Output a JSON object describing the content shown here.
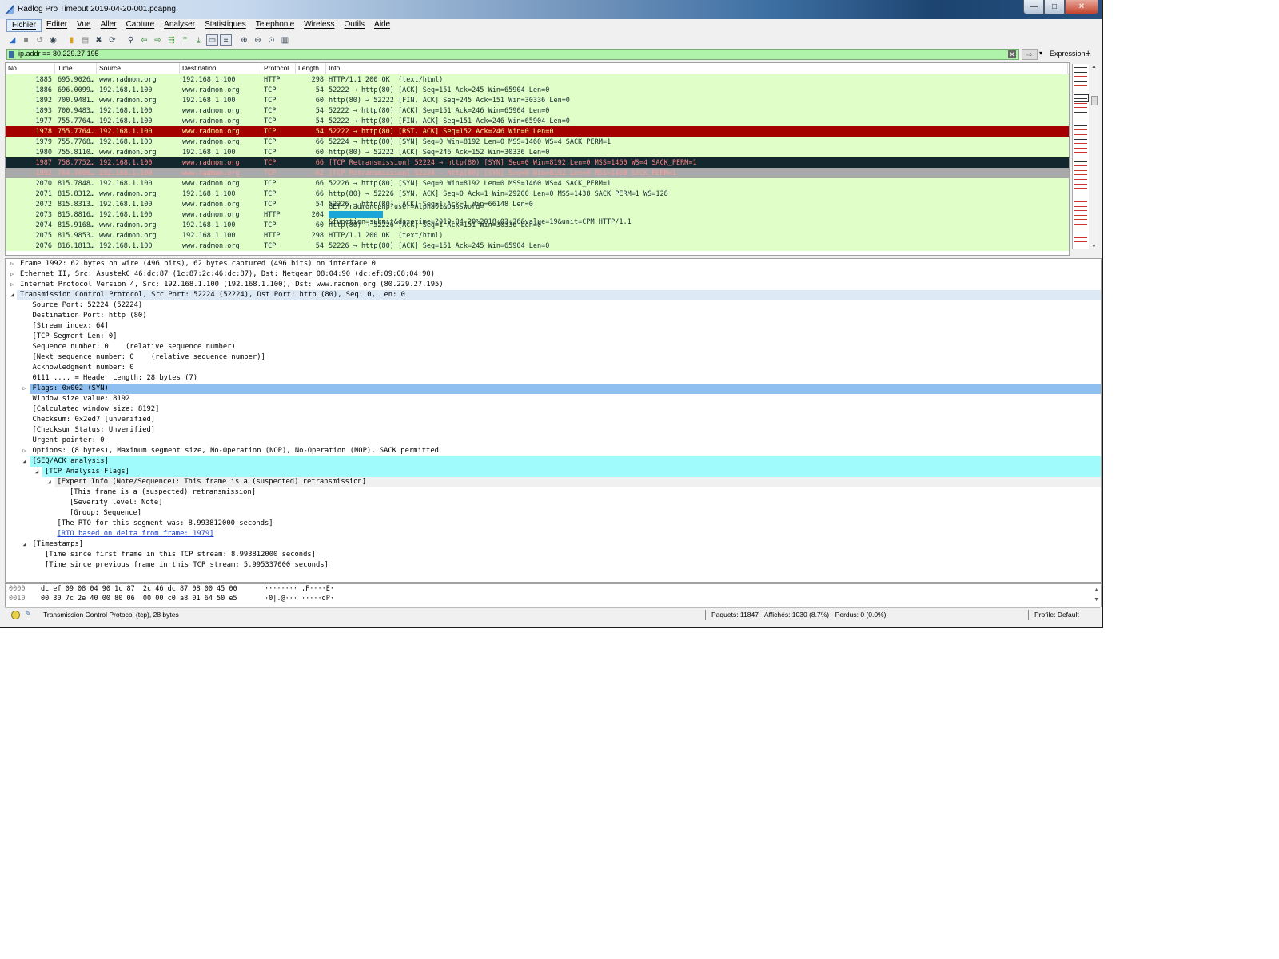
{
  "window": {
    "title": "Radlog Pro Timeout 2019-04-20-001.pcapng"
  },
  "menu": [
    "Fichier",
    "Editer",
    "Vue",
    "Aller",
    "Capture",
    "Analyser",
    "Statistiques",
    "Telephonie",
    "Wireless",
    "Outils",
    "Aide"
  ],
  "filter": {
    "value": "ip.addr == 80.229.27.195",
    "expression_label": "Expression...",
    "plus": "+"
  },
  "packet_list": {
    "headers": [
      "No.",
      "Time",
      "Source",
      "Destination",
      "Protocol",
      "Length",
      "Info"
    ],
    "rows": [
      {
        "no": "1885",
        "time": "695.9026…",
        "src": "www.radmon.org",
        "dst": "192.168.1.100",
        "proto": "HTTP",
        "len": "298",
        "info": "HTTP/1.1 200 OK  (text/html)",
        "style": "green"
      },
      {
        "no": "1886",
        "time": "696.0099…",
        "src": "192.168.1.100",
        "dst": "www.radmon.org",
        "proto": "TCP",
        "len": "54",
        "info": "52222 → http(80) [ACK] Seq=151 Ack=245 Win=65904 Len=0",
        "style": "green"
      },
      {
        "no": "1892",
        "time": "700.9481…",
        "src": "www.radmon.org",
        "dst": "192.168.1.100",
        "proto": "TCP",
        "len": "60",
        "info": "http(80) → 52222 [FIN, ACK] Seq=245 Ack=151 Win=30336 Len=0",
        "style": "green"
      },
      {
        "no": "1893",
        "time": "700.9483…",
        "src": "192.168.1.100",
        "dst": "www.radmon.org",
        "proto": "TCP",
        "len": "54",
        "info": "52222 → http(80) [ACK] Seq=151 Ack=246 Win=65904 Len=0",
        "style": "green"
      },
      {
        "no": "1977",
        "time": "755.7764…",
        "src": "192.168.1.100",
        "dst": "www.radmon.org",
        "proto": "TCP",
        "len": "54",
        "info": "52222 → http(80) [FIN, ACK] Seq=151 Ack=246 Win=65904 Len=0",
        "style": "green"
      },
      {
        "no": "1978",
        "time": "755.7764…",
        "src": "192.168.1.100",
        "dst": "www.radmon.org",
        "proto": "TCP",
        "len": "54",
        "info": "52222 → http(80) [RST, ACK] Seq=152 Ack=246 Win=0 Len=0",
        "style": "red"
      },
      {
        "no": "1979",
        "time": "755.7768…",
        "src": "192.168.1.100",
        "dst": "www.radmon.org",
        "proto": "TCP",
        "len": "66",
        "info": "52224 → http(80) [SYN] Seq=0 Win=8192 Len=0 MSS=1460 WS=4 SACK_PERM=1",
        "style": "green"
      },
      {
        "no": "1980",
        "time": "755.8110…",
        "src": "www.radmon.org",
        "dst": "192.168.1.100",
        "proto": "TCP",
        "len": "60",
        "info": "http(80) → 52222 [ACK] Seq=246 Ack=152 Win=30336 Len=0",
        "style": "green"
      },
      {
        "no": "1987",
        "time": "758.7752…",
        "src": "192.168.1.100",
        "dst": "www.radmon.org",
        "proto": "TCP",
        "len": "66",
        "info": "[TCP Retransmission] 52224 → http(80) [SYN] Seq=0 Win=8192 Len=0 MSS=1460 WS=4 SACK_PERM=1",
        "style": "dark"
      },
      {
        "no": "1992",
        "time": "764.7696…",
        "src": "192.168.1.100",
        "dst": "www.radmon.org",
        "proto": "TCP",
        "len": "62",
        "info": "[TCP Retransmission] 52224 → http(80) [SYN] Seq=0 Win=8192 Len=0 MSS=1460 SACK_PERM=1",
        "style": "selected"
      },
      {
        "no": "2070",
        "time": "815.7848…",
        "src": "192.168.1.100",
        "dst": "www.radmon.org",
        "proto": "TCP",
        "len": "66",
        "info": "52226 → http(80) [SYN] Seq=0 Win=8192 Len=0 MSS=1460 WS=4 SACK_PERM=1",
        "style": "green"
      },
      {
        "no": "2071",
        "time": "815.8312…",
        "src": "www.radmon.org",
        "dst": "192.168.1.100",
        "proto": "TCP",
        "len": "66",
        "info": "http(80) → 52226 [SYN, ACK] Seq=0 Ack=1 Win=29200 Len=0 MSS=1438 SACK_PERM=1 WS=128",
        "style": "green"
      },
      {
        "no": "2072",
        "time": "815.8313…",
        "src": "192.168.1.100",
        "dst": "www.radmon.org",
        "proto": "TCP",
        "len": "54",
        "info": "52226 → http(80) [ACK] Seq=1 Ack=1 Win=66148 Len=0",
        "style": "green"
      },
      {
        "no": "2073",
        "time": "815.8816…",
        "src": "192.168.1.100",
        "dst": "www.radmon.org",
        "proto": "HTTP",
        "len": "204",
        "info_pre": "GET /radmon.php?user=Alpha01&password=",
        "info_post": "&function=submit&datetime=2019-04-20%2018:03:36&value=19&unit=CPM HTTP/1.1",
        "style": "green"
      },
      {
        "no": "2074",
        "time": "815.9168…",
        "src": "www.radmon.org",
        "dst": "192.168.1.100",
        "proto": "TCP",
        "len": "60",
        "info": "http(80) → 52226 [ACK] Seq=1 Ack=151 Win=30336 Len=0",
        "style": "green"
      },
      {
        "no": "2075",
        "time": "815.9853…",
        "src": "www.radmon.org",
        "dst": "192.168.1.100",
        "proto": "HTTP",
        "len": "298",
        "info": "HTTP/1.1 200 OK  (text/html)",
        "style": "green"
      },
      {
        "no": "2076",
        "time": "816.1813…",
        "src": "192.168.1.100",
        "dst": "www.radmon.org",
        "proto": "TCP",
        "len": "54",
        "info": "52226 → http(80) [ACK] Seq=151 Ack=245 Win=65904 Len=0",
        "style": "green"
      }
    ]
  },
  "details": [
    {
      "indent": 0,
      "tw": "▷",
      "text": "Frame 1992: 62 bytes on wire (496 bits), 62 bytes captured (496 bits) on interface 0",
      "bg": ""
    },
    {
      "indent": 0,
      "tw": "▷",
      "text": "Ethernet II, Src: AsustekC_46:dc:87 (1c:87:2c:46:dc:87), Dst: Netgear_08:04:90 (dc:ef:09:08:04:90)",
      "bg": ""
    },
    {
      "indent": 0,
      "tw": "▷",
      "text": "Internet Protocol Version 4, Src: 192.168.1.100 (192.168.1.100), Dst: www.radmon.org (80.229.27.195)",
      "bg": ""
    },
    {
      "indent": 0,
      "tw": "◢",
      "text": "Transmission Control Protocol, Src Port: 52224 (52224), Dst Port: http (80), Seq: 0, Len: 0",
      "bg": "#dde9f5"
    },
    {
      "indent": 1,
      "tw": "",
      "text": "Source Port: 52224 (52224)",
      "bg": ""
    },
    {
      "indent": 1,
      "tw": "",
      "text": "Destination Port: http (80)",
      "bg": ""
    },
    {
      "indent": 1,
      "tw": "",
      "text": "[Stream index: 64]",
      "bg": ""
    },
    {
      "indent": 1,
      "tw": "",
      "text": "[TCP Segment Len: 0]",
      "bg": ""
    },
    {
      "indent": 1,
      "tw": "",
      "text": "Sequence number: 0    (relative sequence number)",
      "bg": ""
    },
    {
      "indent": 1,
      "tw": "",
      "text": "[Next sequence number: 0    (relative sequence number)]",
      "bg": ""
    },
    {
      "indent": 1,
      "tw": "",
      "text": "Acknowledgment number: 0",
      "bg": ""
    },
    {
      "indent": 1,
      "tw": "",
      "text": "0111 .... = Header Length: 28 bytes (7)",
      "bg": ""
    },
    {
      "indent": 1,
      "tw": "▷",
      "text": "Flags: 0x002 (SYN)",
      "bg": "#8fbff0"
    },
    {
      "indent": 1,
      "tw": "",
      "text": "Window size value: 8192",
      "bg": ""
    },
    {
      "indent": 1,
      "tw": "",
      "text": "[Calculated window size: 8192]",
      "bg": ""
    },
    {
      "indent": 1,
      "tw": "",
      "text": "Checksum: 0x2ed7 [unverified]",
      "bg": ""
    },
    {
      "indent": 1,
      "tw": "",
      "text": "[Checksum Status: Unverified]",
      "bg": ""
    },
    {
      "indent": 1,
      "tw": "",
      "text": "Urgent pointer: 0",
      "bg": ""
    },
    {
      "indent": 1,
      "tw": "▷",
      "text": "Options: (8 bytes), Maximum segment size, No-Operation (NOP), No-Operation (NOP), SACK permitted",
      "bg": ""
    },
    {
      "indent": 1,
      "tw": "◢",
      "text": "[SEQ/ACK analysis]",
      "bg": "#a0fbfd"
    },
    {
      "indent": 2,
      "tw": "◢",
      "text": "[TCP Analysis Flags]",
      "bg": "#a0fbfd"
    },
    {
      "indent": 3,
      "tw": "◢",
      "text": "[Expert Info (Note/Sequence): This frame is a (suspected) retransmission]",
      "bg": "#f0f0f0"
    },
    {
      "indent": 4,
      "tw": "",
      "text": "[This frame is a (suspected) retransmission]",
      "bg": ""
    },
    {
      "indent": 4,
      "tw": "",
      "text": "[Severity level: Note]",
      "bg": ""
    },
    {
      "indent": 4,
      "tw": "",
      "text": "[Group: Sequence]",
      "bg": ""
    },
    {
      "indent": 3,
      "tw": "",
      "text": "[The RTO for this segment was: 8.993812000 seconds]",
      "bg": ""
    },
    {
      "indent": 3,
      "tw": "",
      "text": "[RTO based on delta from frame: 1979]",
      "bg": "",
      "link": true
    },
    {
      "indent": 1,
      "tw": "◢",
      "text": "[Timestamps]",
      "bg": ""
    },
    {
      "indent": 2,
      "tw": "",
      "text": "[Time since first frame in this TCP stream: 8.993812000 seconds]",
      "bg": ""
    },
    {
      "indent": 2,
      "tw": "",
      "text": "[Time since previous frame in this TCP stream: 5.995337000 seconds]",
      "bg": ""
    }
  ],
  "bytes": [
    {
      "offset": "0000",
      "hex": "dc ef 09 08 04 90 1c 87  2c 46 dc 87 08 00 45 00",
      "ascii": "········ ,F····E·"
    },
    {
      "offset": "0010",
      "hex": "00 30 7c 2e 40 00 80 06  00 00 c0 a8 01 64 50 e5",
      "ascii": "·0|.@··· ·····dP·"
    }
  ],
  "status": {
    "left": "Transmission Control Protocol (tcp), 28 bytes",
    "packets": "Paquets: 11847 · Affichés: 1030 (8.7%) · Perdus: 0 (0.0%)",
    "profile": "Profile: Default"
  },
  "colors": {
    "green": "#e0ffc8",
    "red": "#a40000",
    "dark": "#12272e",
    "selected": "#a9a9a9"
  }
}
